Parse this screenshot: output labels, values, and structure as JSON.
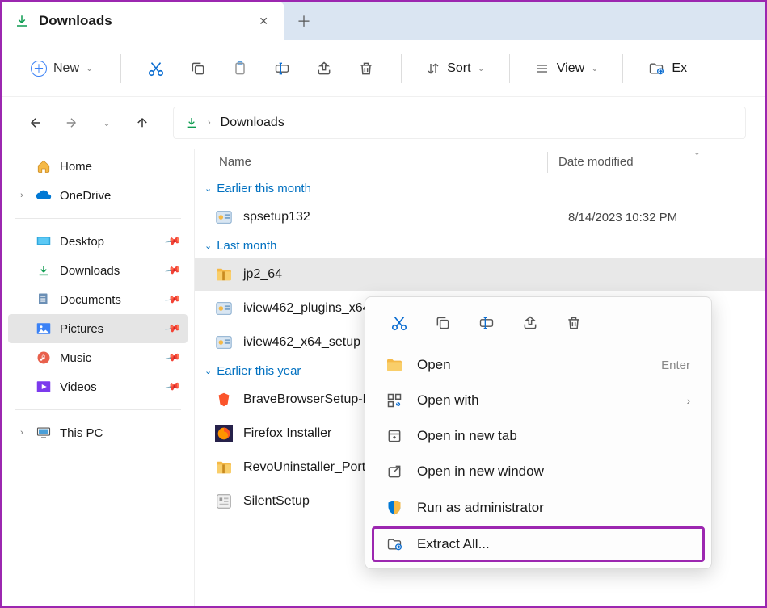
{
  "tab": {
    "title": "Downloads"
  },
  "toolbar": {
    "new_label": "New",
    "sort_label": "Sort",
    "view_label": "View",
    "extract_label": "Ex"
  },
  "breadcrumb": {
    "current": "Downloads"
  },
  "columns": {
    "name": "Name",
    "date": "Date modified"
  },
  "sidebar": {
    "home": "Home",
    "onedrive": "OneDrive",
    "desktop": "Desktop",
    "downloads": "Downloads",
    "documents": "Documents",
    "pictures": "Pictures",
    "music": "Music",
    "videos": "Videos",
    "thispc": "This PC"
  },
  "groups": [
    {
      "label": "Earlier this month",
      "files": [
        {
          "name": "spsetup132",
          "date": "8/14/2023 10:32 PM",
          "icon": "installer"
        }
      ]
    },
    {
      "label": "Last month",
      "files": [
        {
          "name": "jp2_64",
          "date": "",
          "icon": "zip",
          "selected": true
        },
        {
          "name": "iview462_plugins_x64",
          "date": "",
          "icon": "installer"
        },
        {
          "name": "iview462_x64_setup",
          "date": "",
          "icon": "installer"
        }
      ]
    },
    {
      "label": "Earlier this year",
      "files": [
        {
          "name": "BraveBrowserSetup-B",
          "date": "",
          "icon": "brave"
        },
        {
          "name": "Firefox Installer",
          "date": "",
          "icon": "firefox"
        },
        {
          "name": "RevoUninstaller_Porta",
          "date": "",
          "icon": "zip"
        },
        {
          "name": "SilentSetup",
          "date": "",
          "icon": "exe"
        }
      ]
    }
  ],
  "context_menu": {
    "open": "Open",
    "open_shortcut": "Enter",
    "open_with": "Open with",
    "open_new_tab": "Open in new tab",
    "open_new_window": "Open in new window",
    "run_admin": "Run as administrator",
    "extract_all": "Extract All..."
  }
}
